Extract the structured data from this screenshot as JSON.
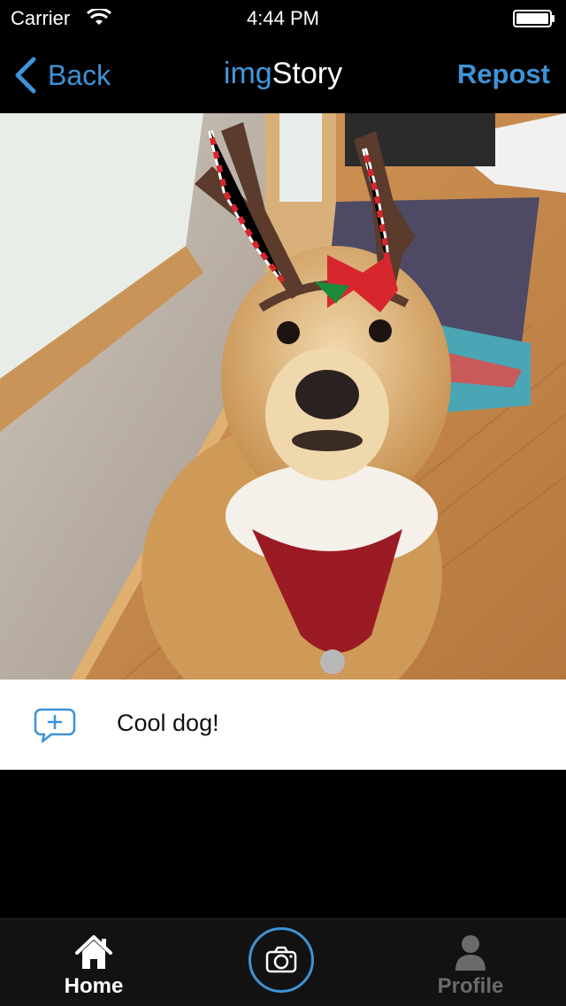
{
  "status_bar": {
    "carrier": "Carrier",
    "time": "4:44 PM"
  },
  "nav": {
    "back_label": "Back",
    "title_part_1": "img",
    "title_part_2": "Story",
    "repost_label": "Repost"
  },
  "post": {
    "caption": "Cool dog!"
  },
  "tab_bar": {
    "home_label": "Home",
    "profile_label": "Profile",
    "active_tab": "Home"
  },
  "colors": {
    "accent": "#3e93d6",
    "background": "#000000",
    "caption_background": "#ffffff",
    "tab_inactive": "#6a6a6a"
  },
  "icons": [
    "wifi-icon",
    "battery-icon",
    "back-chevron-icon",
    "comment-add-icon",
    "home-icon",
    "camera-icon",
    "profile-icon"
  ]
}
